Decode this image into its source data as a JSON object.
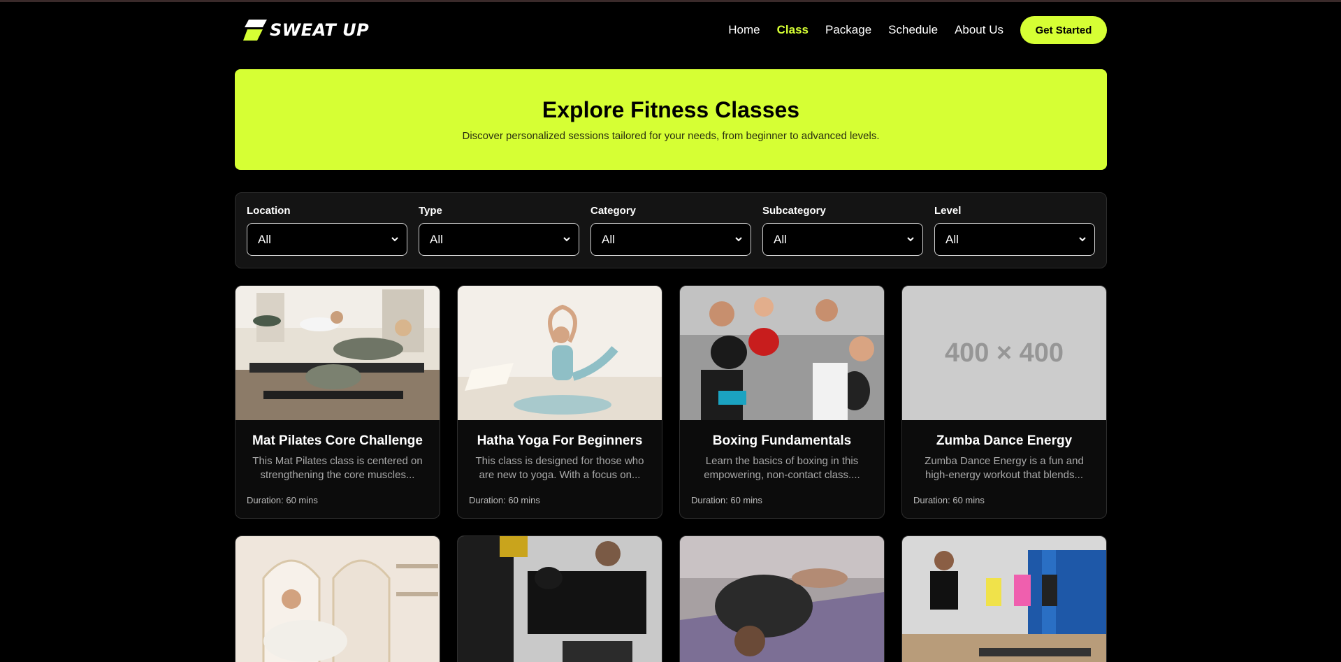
{
  "brand": {
    "name": "SWEAT UP",
    "accent": "#d6ff34"
  },
  "nav": {
    "items": [
      {
        "label": "Home",
        "active": false
      },
      {
        "label": "Class",
        "active": true
      },
      {
        "label": "Package",
        "active": false
      },
      {
        "label": "Schedule",
        "active": false
      },
      {
        "label": "About Us",
        "active": false
      }
    ],
    "cta_label": "Get Started"
  },
  "hero": {
    "title": "Explore Fitness Classes",
    "subtitle": "Discover personalized sessions tailored for your needs, from beginner to advanced levels."
  },
  "filters": [
    {
      "label": "Location",
      "value": "All"
    },
    {
      "label": "Type",
      "value": "All"
    },
    {
      "label": "Category",
      "value": "All"
    },
    {
      "label": "Subcategory",
      "value": "All"
    },
    {
      "label": "Level",
      "value": "All"
    }
  ],
  "classes": [
    {
      "title": "Mat Pilates Core Challenge",
      "description": "This Mat Pilates class is centered on strengthening the core muscles...",
      "duration": "Duration: 60 mins",
      "image": "pilates-reformer-photo"
    },
    {
      "title": "Hatha Yoga For Beginners",
      "description": "This class is designed for those who are new to yoga. With a focus on...",
      "duration": "Duration: 60 mins",
      "image": "yoga-pose-photo"
    },
    {
      "title": "Boxing Fundamentals",
      "description": "Learn the basics of boxing in this empowering, non-contact class....",
      "duration": "Duration: 60 mins",
      "image": "boxing-class-photo"
    },
    {
      "title": "Zumba Dance Energy",
      "description": "Zumba Dance Energy is a fun and high-energy workout that blends...",
      "duration": "Duration: 60 mins",
      "image": "placeholder",
      "placeholder_text": "400 × 400"
    }
  ],
  "classes_row2": [
    {
      "image": "studio-stretch-photo"
    },
    {
      "image": "kickboxing-bag-photo"
    },
    {
      "image": "yoga-childs-pose-photo"
    },
    {
      "image": "step-aerobics-photo"
    }
  ]
}
